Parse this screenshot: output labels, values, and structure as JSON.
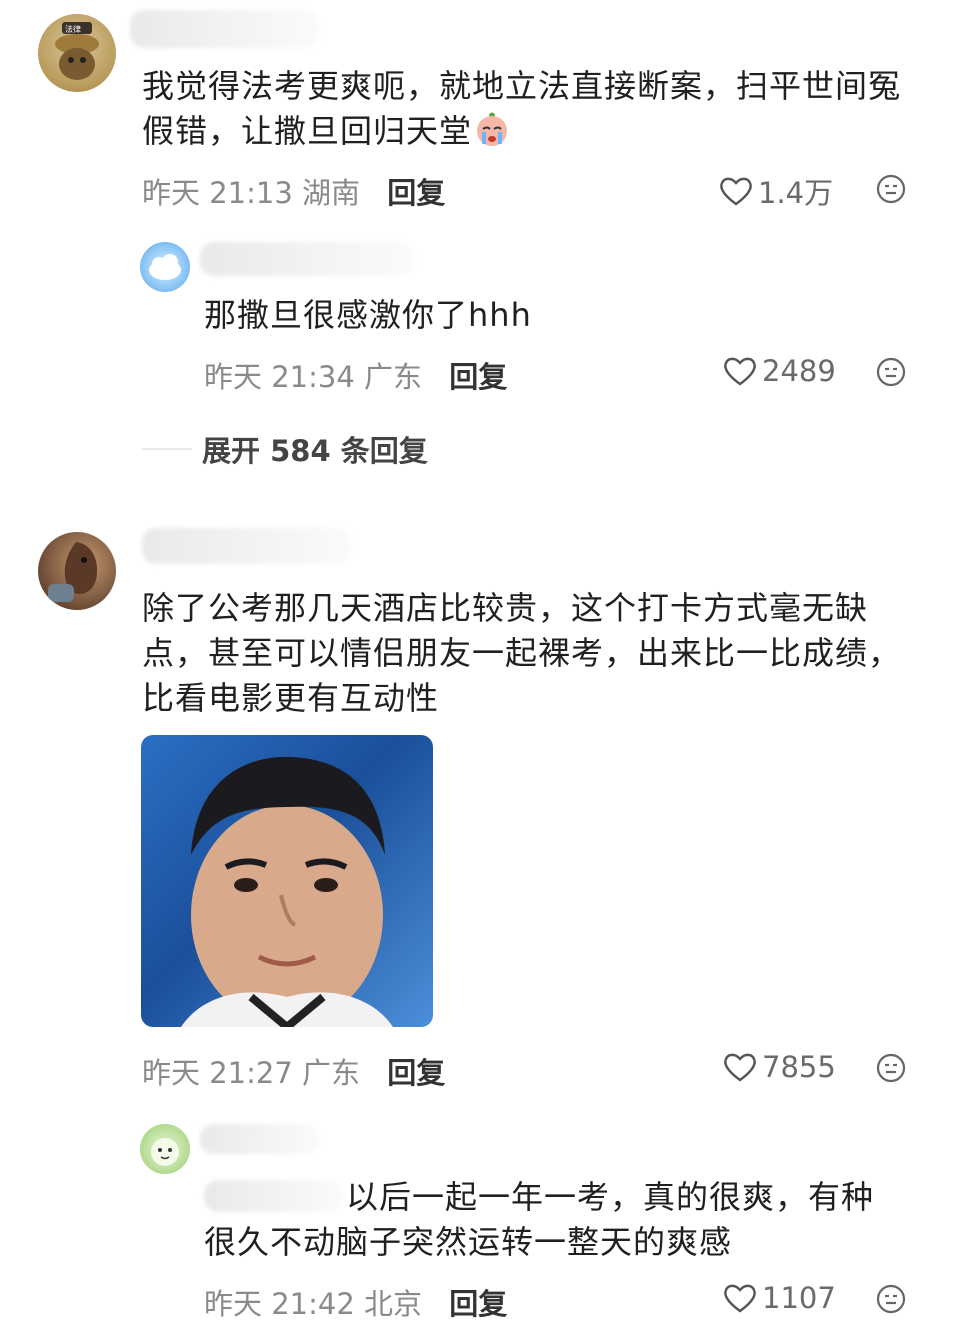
{
  "comments": [
    {
      "text": "我觉得法考更爽呃，就地立法直接断案，扫平世间冤假错，让撒旦回归天堂",
      "time": "昨天 21:13",
      "location": "湖南",
      "reply_label": "回复",
      "likes": "1.4万",
      "avatar_badge": "法律",
      "replies": [
        {
          "text": "那撒旦很感激你了hhh",
          "time": "昨天 21:34",
          "location": "广东",
          "reply_label": "回复",
          "likes": "2489"
        }
      ],
      "expand_label": "展开 584 条回复"
    },
    {
      "text": "除了公考那几天酒店比较贵，这个打卡方式毫无缺点，甚至可以情侣朋友一起裸考，出来比一比成绩，比看电影更有互动性",
      "time": "昨天 21:27",
      "location": "广东",
      "reply_label": "回复",
      "likes": "7855",
      "replies": [
        {
          "text": "以后一起一年一考，真的很爽，有种很久不动脑子突然运转一整天的爽感",
          "time": "昨天 21:42",
          "location": "北京",
          "reply_label": "回复",
          "likes": "1107"
        }
      ]
    }
  ]
}
